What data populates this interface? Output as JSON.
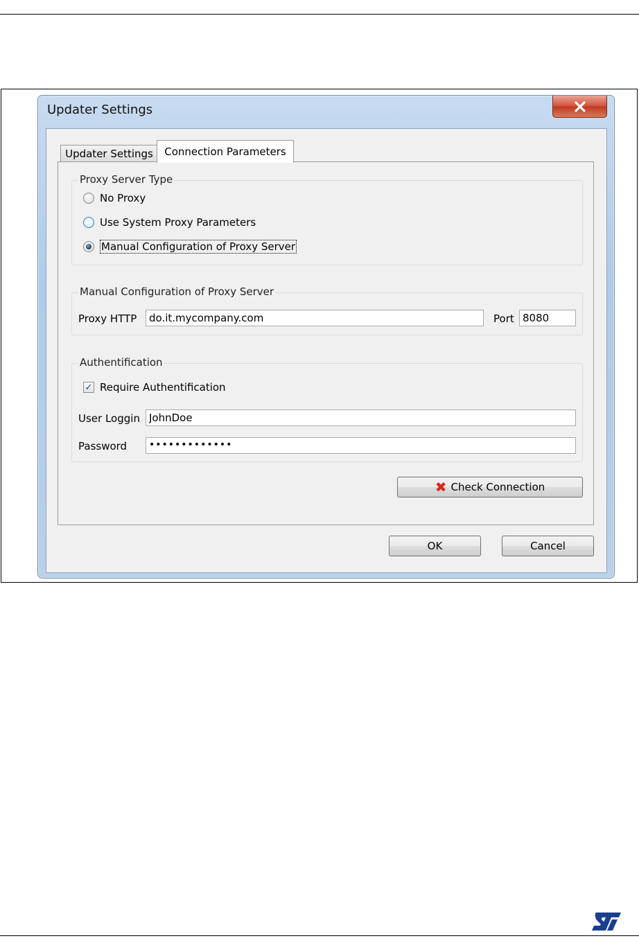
{
  "dialog": {
    "title": "Updater Settings",
    "close_icon": "close-icon",
    "tabs": [
      {
        "label": "Updater Settings",
        "active": false
      },
      {
        "label": "Connection Parameters",
        "active": true
      }
    ],
    "proxy_type": {
      "legend": "Proxy Server Type",
      "options": [
        {
          "label": "No Proxy",
          "selected": false
        },
        {
          "label": "Use System Proxy Parameters",
          "selected": false
        },
        {
          "label": "Manual Configuration of Proxy Server",
          "selected": true
        }
      ]
    },
    "manual_config": {
      "legend": "Manual Configuration of Proxy Server",
      "proxy_label": "Proxy HTTP",
      "proxy_value": "do.it.mycompany.com",
      "port_label": "Port",
      "port_value": "8080"
    },
    "auth": {
      "legend": "Authentification",
      "require_label": "Require Authentification",
      "require_checked": true,
      "login_label": "User Loggin",
      "login_value": "JohnDoe",
      "password_label": "Password",
      "password_value": "•••••••••••••"
    },
    "check_button": {
      "label": "Check Connection",
      "icon": "red-x-icon"
    },
    "ok_label": "OK",
    "cancel_label": "Cancel"
  },
  "colors": {
    "close_red": "#c03a22",
    "title_bar": "#aecbe9",
    "logo_blue": "#1a3f8f"
  }
}
